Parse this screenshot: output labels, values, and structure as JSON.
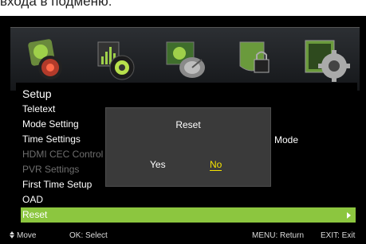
{
  "caption": "входа в подменю:",
  "icons": [
    {
      "name": "picture-icon"
    },
    {
      "name": "sound-icon"
    },
    {
      "name": "channel-icon"
    },
    {
      "name": "lock-icon"
    },
    {
      "name": "setup-icon"
    }
  ],
  "menu": {
    "title": "Setup",
    "items": [
      {
        "label": "Teletext",
        "state": "normal"
      },
      {
        "label": "Mode Setting",
        "state": "normal"
      },
      {
        "label": "Time Settings",
        "state": "normal"
      },
      {
        "label": "HDMI CEC Control",
        "state": "disabled"
      },
      {
        "label": "PVR Settings",
        "state": "disabled"
      },
      {
        "label": "First Time Setup",
        "state": "normal"
      },
      {
        "label": "OAD",
        "state": "normal"
      },
      {
        "label": "Reset",
        "state": "selected"
      }
    ],
    "mode_value": "Mode"
  },
  "dialog": {
    "title": "Reset",
    "yes_label": "Yes",
    "no_label": "No"
  },
  "footer": {
    "move": "Move",
    "select": "OK: Select",
    "return": "MENU: Return",
    "exit": "EXIT: Exit"
  },
  "colors": {
    "selected_bar": "#8cc63f",
    "focused_button": "#f5e400"
  }
}
